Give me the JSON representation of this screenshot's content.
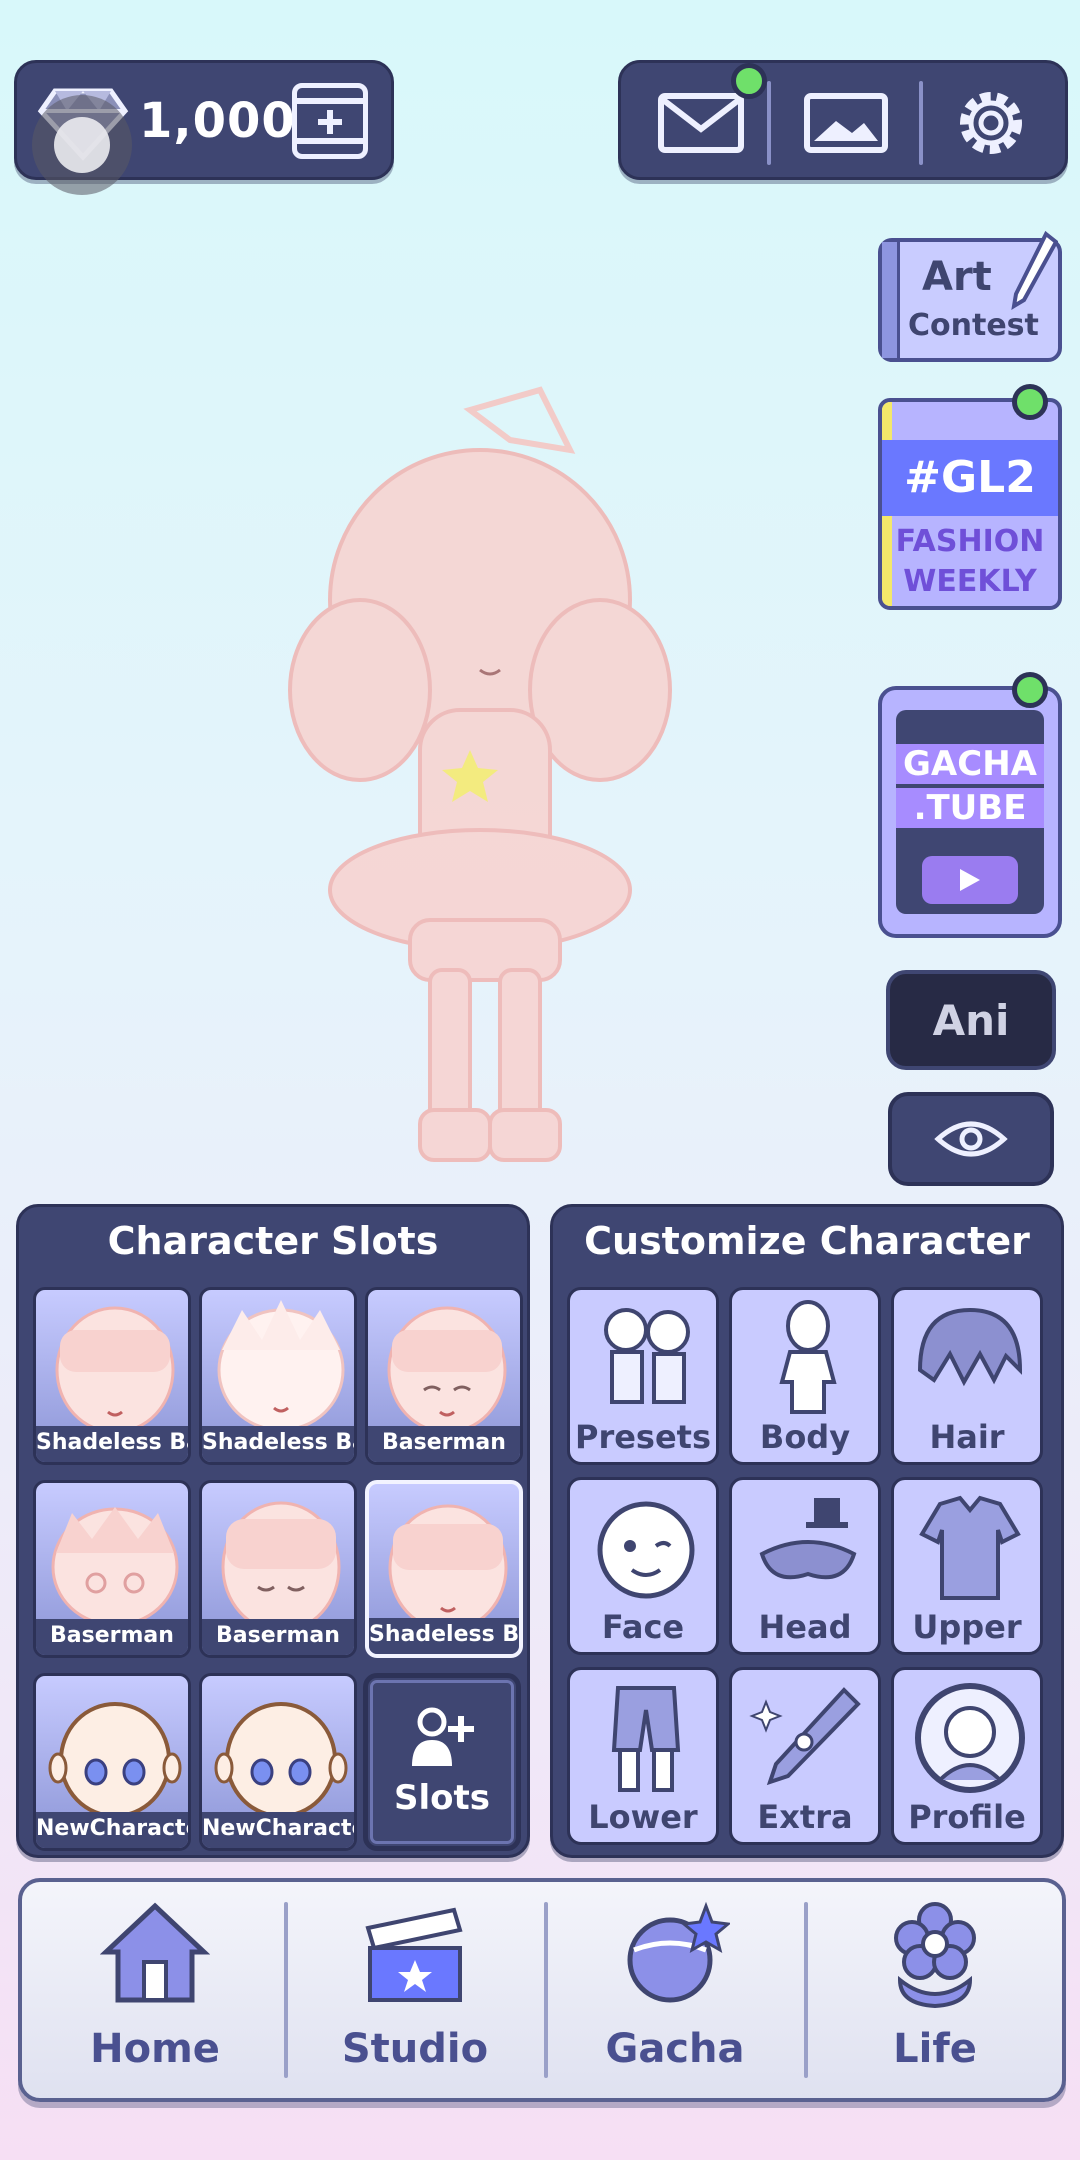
{
  "currency": {
    "amount": "1,000"
  },
  "side_buttons": {
    "art_contest": {
      "line1": "Art",
      "line2": "Contest"
    },
    "gl2": {
      "title": "#GL2",
      "line1": "FASHION",
      "line2": "WEEKLY"
    },
    "gacha_tube": {
      "line1": "GACHA",
      "line2": ".TUBE"
    },
    "ani_label": "Ani"
  },
  "character_slots": {
    "title": "Character Slots",
    "slots": [
      {
        "label": "Shadeless Bas"
      },
      {
        "label": "Shadeless Bas"
      },
      {
        "label": "Baserman"
      },
      {
        "label": "Baserman"
      },
      {
        "label": "Baserman"
      },
      {
        "label": "Shadeless Bas",
        "selected": true
      },
      {
        "label": "NewCharacter"
      },
      {
        "label": "NewCharacter"
      }
    ],
    "add_label": "Slots"
  },
  "customize": {
    "title": "Customize Character",
    "items": [
      {
        "label": "Presets",
        "icon": "presets-icon"
      },
      {
        "label": "Body",
        "icon": "body-icon"
      },
      {
        "label": "Hair",
        "icon": "hair-icon"
      },
      {
        "label": "Face",
        "icon": "face-icon"
      },
      {
        "label": "Head",
        "icon": "head-icon"
      },
      {
        "label": "Upper",
        "icon": "upper-icon"
      },
      {
        "label": "Lower",
        "icon": "lower-icon"
      },
      {
        "label": "Extra",
        "icon": "extra-icon"
      },
      {
        "label": "Profile",
        "icon": "profile-icon"
      }
    ]
  },
  "nav": [
    {
      "label": "Home",
      "icon": "home-icon"
    },
    {
      "label": "Studio",
      "icon": "clapperboard-icon"
    },
    {
      "label": "Gacha",
      "icon": "gacha-icon"
    },
    {
      "label": "Life",
      "icon": "flower-icon"
    }
  ],
  "colors": {
    "panel": "#3f4672",
    "tile": "#c9cbff",
    "accent": "#6fe06a",
    "nav_text": "#4a5090"
  }
}
